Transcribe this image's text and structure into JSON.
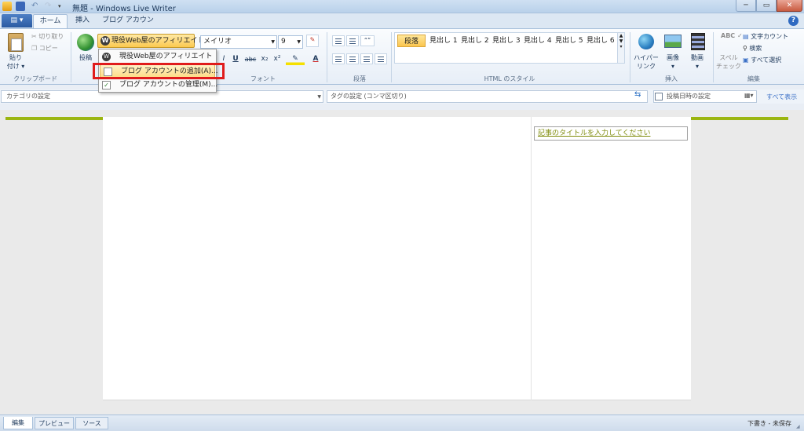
{
  "window": {
    "title": "無題 - Windows Live Writer",
    "minimize": "─",
    "maximize": "▭",
    "close": "✕"
  },
  "quick_access": {
    "undo": "↶",
    "redo": "↷",
    "customize": "▾"
  },
  "app_menu": {
    "label": "▤ ▾"
  },
  "tabs": [
    {
      "label": "ホーム",
      "selected": true
    },
    {
      "label": "挿入"
    },
    {
      "label": "ブログ アカウント"
    }
  ],
  "help": "?",
  "ribbon": {
    "clipboard": {
      "paste": "貼り\n付け ▾",
      "cut": "切り取り",
      "copy": "コピー",
      "group_label": "クリップボード"
    },
    "publish": {
      "label": "投稿"
    },
    "blog_select": {
      "label": "現役Web屋のアフィリエイト ▾"
    },
    "font": {
      "family": "メイリオ",
      "size": "9",
      "group_label": "フォント",
      "buttons": [
        "I",
        "U",
        "abc",
        "x₂",
        "x²",
        "✎",
        "A"
      ]
    },
    "paragraph": {
      "group_label": "段落"
    },
    "html_styles": {
      "items": [
        "段落",
        "見出し 1",
        "見出し 2",
        "見出し 3",
        "見出し 4",
        "見出し 5",
        "見出し 6"
      ],
      "group_label": "HTML のスタイル"
    },
    "insert": {
      "hyperlink": "ハイパー\nリンク",
      "picture": "画像\n▾",
      "video": "動画\n▾",
      "group_label": "挿入"
    },
    "editing": {
      "spell": "スペル\nチェック",
      "spell_icon": "ABC ✓",
      "word_count": "文字カウント",
      "find": "検索",
      "select_all": "すべて選択",
      "group_label": "編集"
    }
  },
  "fields": {
    "category": "カテゴリの設定",
    "tags": "タグの設定 (コンマ区切り)",
    "post_date": "投稿日時の設定",
    "show_all": "すべて表示"
  },
  "editor": {
    "title_placeholder": "記事のタイトルを入力してください"
  },
  "blog_menu": {
    "items": [
      "現役Web屋のアフィリエイト",
      "ブログ アカウントの追加(A)...",
      "ブログ アカウントの管理(M)..."
    ]
  },
  "view_tabs": [
    "編集",
    "プレビュー",
    "ソース"
  ],
  "status": "下書き - 未保存",
  "colors": {
    "highlight": "#e01c1c",
    "accent_green": "#9bb50f",
    "menu_hover": "#fddd8a"
  }
}
